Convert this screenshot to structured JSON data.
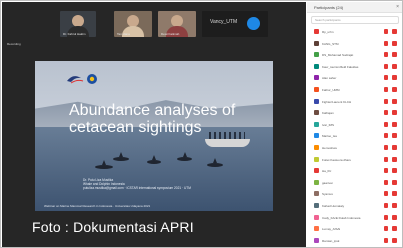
{
  "meeting": {
    "tiles": [
      {
        "name": "Dr. Fahrul Hakim"
      },
      {
        "name": "Tan Hana"
      },
      {
        "name": "Dewi Fatimah"
      },
      {
        "name": "Vancy_UTM"
      }
    ],
    "left_tag": "Recording"
  },
  "slide": {
    "title_line1": "Abundance analyses of",
    "title_line2": "cetacean sightings",
    "credit_line1": "Dr. Putu Liza Mustika",
    "credit_line2": "Whale and Dolphin Indonesia",
    "credit_line3": "putuliza.mustika@gmail.com · ICSTAR international symposium 2021 · UTM",
    "bottom_line": "Webinar on Marine Mammal Research in Indonesia · Universitas Udayana 2021"
  },
  "watermark": "Foto : Dokumentasi APRI",
  "sidebar": {
    "title": "Participants (24)",
    "search_placeholder": "Search participants",
    "participants": [
      {
        "name": "Rp_urhn",
        "color": "#e53935"
      },
      {
        "name": "KANG_STM",
        "color": "#5d4037"
      },
      {
        "name": "DS_Muhamad Sudrajat",
        "color": "#43a047"
      },
      {
        "name": "Kaur_tourism/field Fakultas",
        "color": "#00897b"
      },
      {
        "name": "Alan saher",
        "color": "#8e24aa"
      },
      {
        "name": "Fathur_UMM",
        "color": "#f4511e"
      },
      {
        "name": "Fighter/Laurent KLCH",
        "color": "#3949ab"
      },
      {
        "name": "Kalhajan",
        "color": "#6d4c41"
      },
      {
        "name": "Ivar_IMS",
        "color": "#26a69a"
      },
      {
        "name": "Marloo_tsa",
        "color": "#1e88e5"
      },
      {
        "name": "Hemoshwe",
        "color": "#fb8c00"
      },
      {
        "name": "Foitet Kaotuora dharu",
        "color": "#c0ca33"
      },
      {
        "name": "Ha_IIU",
        "color": "#e53935"
      },
      {
        "name": "gaanvai",
        "color": "#7cb342"
      },
      {
        "name": "Syamus",
        "color": "#8d6e63"
      },
      {
        "name": "Kahad Humataiy",
        "color": "#546e7a"
      },
      {
        "name": "Cady_FAcE Duiab Indonesia",
        "color": "#f06292"
      },
      {
        "name": "Lumay_AISAl",
        "color": "#ff7043"
      },
      {
        "name": "Ramian_ipsk",
        "color": "#ab47bc"
      }
    ]
  }
}
